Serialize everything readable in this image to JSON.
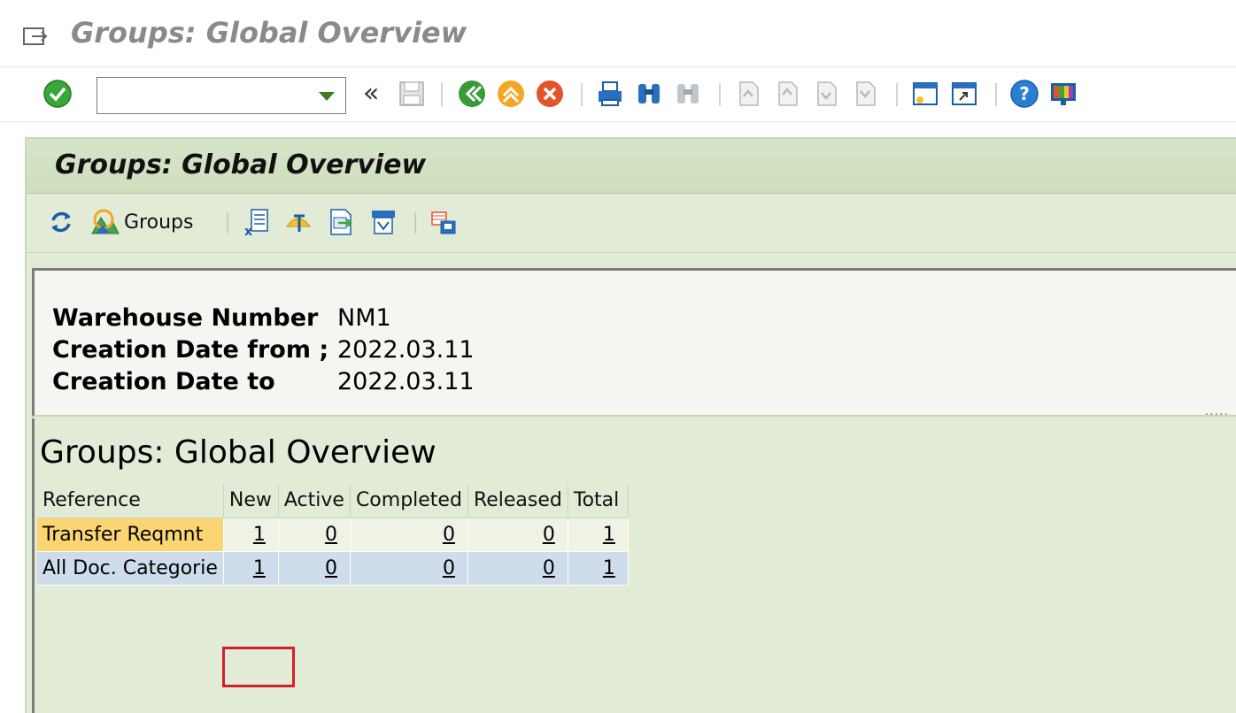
{
  "window": {
    "title": "Groups: Global Overview"
  },
  "toolbar": {
    "command_field_value": "",
    "icons": [
      "enter-icon",
      "command-dropdown-icon",
      "double-left-icon",
      "save-icon",
      "back-icon",
      "exit-icon",
      "cancel-icon",
      "print-icon",
      "find-icon",
      "find-next-icon",
      "first-page-icon",
      "previous-page-icon",
      "next-page-icon",
      "last-page-icon",
      "create-session-icon",
      "shortcut-icon",
      "help-icon",
      "customize-layout-icon"
    ],
    "double_left_label": "«"
  },
  "screen": {
    "title": "Groups: Global Overview"
  },
  "app_toolbar": {
    "groups_label": "Groups",
    "icons": [
      "refresh-icon",
      "groups-icon",
      "excel-export-icon",
      "filter-icon",
      "local-file-icon",
      "word-processing-icon",
      "layout-icon"
    ]
  },
  "header_info": {
    "rows": [
      {
        "label": "Warehouse Number",
        "value": "NM1"
      },
      {
        "label": "Creation Date from ;",
        "value": "2022.03.11"
      },
      {
        "label": "Creation Date to",
        "value": "2022.03.11"
      }
    ],
    "splitter_handle": "....."
  },
  "list": {
    "title": "Groups: Global Overview",
    "columns": [
      "Reference",
      "New",
      "Active",
      "Completed",
      "Released",
      "Total"
    ],
    "rows": [
      {
        "reference": "Transfer Reqmnt",
        "new": "1",
        "active": "0",
        "completed": "0",
        "released": "0",
        "total": "1"
      },
      {
        "reference": "All Doc. Categorie",
        "new": "1",
        "active": "0",
        "completed": "0",
        "released": "0",
        "total": "1"
      }
    ]
  },
  "colors": {
    "header_green": "#d6e4c8",
    "area_green": "#e1ebd6",
    "highlight_yellow": "#fbd571",
    "highlight_blue": "#cfdcec",
    "annotation_red": "#d51f26"
  }
}
